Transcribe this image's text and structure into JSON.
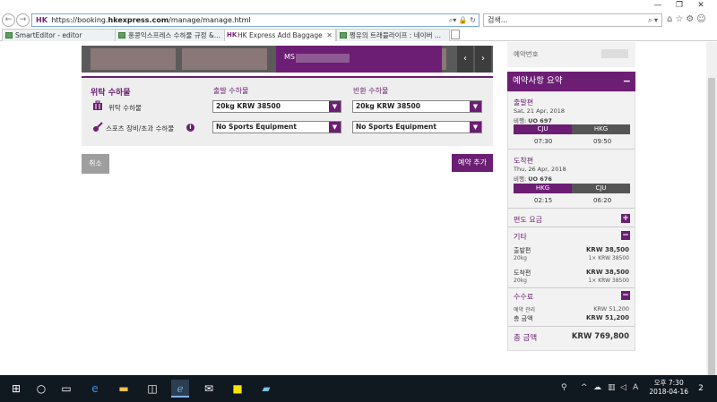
{
  "browser": {
    "url_prefix": "https://booking.",
    "url_domain": "hkexpress.com",
    "url_path": "/manage/manage.html",
    "search_placeholder": "검색...",
    "hk_logo": "HK",
    "window_controls": [
      "—",
      "❐",
      "✕"
    ],
    "tabs": [
      {
        "label": "SmartEditor - editor",
        "icon": "green-editor-icon"
      },
      {
        "label": "홍콩익스프레스 수하물 규정 &...",
        "icon": "green-editor-icon"
      },
      {
        "label": "HK Express Add Baggage",
        "icon": "hk-icon",
        "active": true
      },
      {
        "label": "쩡유의 트래블라이프 : 네이버 ...",
        "icon": "green-editor-icon"
      }
    ]
  },
  "passengers": {
    "active_label": "MS"
  },
  "baggage": {
    "section_title": "위탁 수하물",
    "col_outbound": "출발 수하물",
    "col_return": "반환 수하물",
    "checked_label": "위탁 수하물",
    "checked_outbound": "20kg KRW 38500",
    "checked_return": "20kg KRW 38500",
    "sports_label": "스포츠 장비/초과 수하물",
    "sports_outbound": "No Sports Equipment",
    "sports_return": "No Sports Equipment"
  },
  "actions": {
    "cancel": "취소",
    "add_booking": "예약 추가"
  },
  "summary": {
    "booking_ref_label": "예약번호",
    "title": "예약사항 요약",
    "outbound_title": "출발편",
    "outbound_date": "Sat, 21 Apr, 2018",
    "outbound_flight_label": "비행:",
    "outbound_flight": "UO 697",
    "outbound_from": "CJU",
    "outbound_to": "HKG",
    "outbound_dep": "07:30",
    "outbound_arr": "09:50",
    "return_title": "도착편",
    "return_date": "Thu, 26 Apr, 2018",
    "return_flight_label": "비행:",
    "return_flight": "UO 676",
    "return_from": "HKG",
    "return_to": "CJU",
    "return_dep": "02:15",
    "return_arr": "06:20",
    "fare_label": "편도 요금",
    "other_label": "기타",
    "out_item": "출발편",
    "out_item_price": "KRW 38,500",
    "out_item_sub": "20kg",
    "out_item_sub_price": "1× KRW 38500",
    "ret_item": "도착편",
    "ret_item_price": "KRW 38,500",
    "ret_item_sub": "20kg",
    "ret_item_sub_price": "1× KRW 38500",
    "fees_label": "수수료",
    "mgmt_label": "예약 관리",
    "mgmt_price": "KRW 51,200",
    "fees_total_label": "총 금액",
    "fees_total": "KRW 51,200",
    "grand_label": "총 금액",
    "grand_total": "KRW 769,800"
  },
  "taskbar": {
    "time": "오후 7:30",
    "date": "2018-04-16",
    "notifications": "2"
  }
}
